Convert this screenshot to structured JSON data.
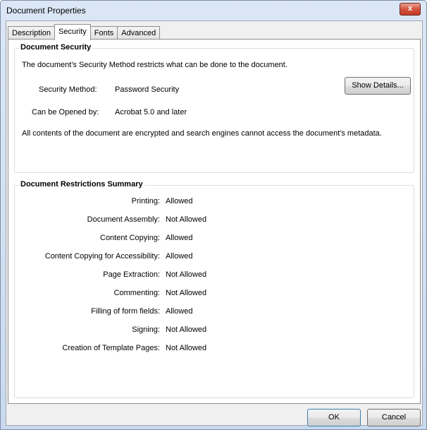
{
  "window": {
    "title": "Document Properties",
    "close_label": "x"
  },
  "tabs": [
    {
      "label": "Description",
      "active": false
    },
    {
      "label": "Security",
      "active": true
    },
    {
      "label": "Fonts",
      "active": false
    },
    {
      "label": "Advanced",
      "active": false
    }
  ],
  "document_security": {
    "group_label": "Document Security",
    "description": "The document's Security Method restricts what can be done to the document.",
    "security_method_label": "Security Method:",
    "security_method_value": "Password Security",
    "show_details_label": "Show Details...",
    "opened_by_label": "Can be Opened by:",
    "opened_by_value": "Acrobat 5.0 and later",
    "note": "All contents of the document are encrypted and search engines cannot access the document's metadata."
  },
  "restrictions": {
    "group_label": "Document Restrictions Summary",
    "rows": [
      {
        "label": "Printing:",
        "value": "Allowed"
      },
      {
        "label": "Document Assembly:",
        "value": "Not Allowed"
      },
      {
        "label": "Content Copying:",
        "value": "Allowed"
      },
      {
        "label": "Content Copying for Accessibility:",
        "value": "Allowed"
      },
      {
        "label": "Page Extraction:",
        "value": "Not Allowed"
      },
      {
        "label": "Commenting:",
        "value": "Not Allowed"
      },
      {
        "label": "Filling of form fields:",
        "value": "Allowed"
      },
      {
        "label": "Signing:",
        "value": "Not Allowed"
      },
      {
        "label": "Creation of Template Pages:",
        "value": "Not Allowed"
      }
    ]
  },
  "buttons": {
    "ok": "OK",
    "cancel": "Cancel"
  }
}
